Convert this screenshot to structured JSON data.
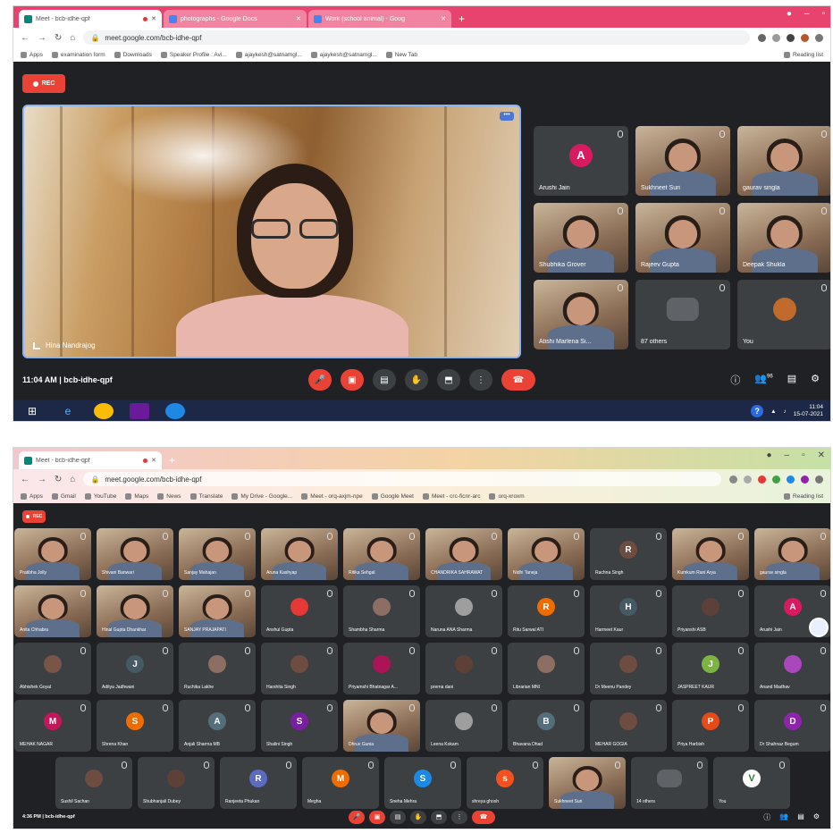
{
  "screen1": {
    "tabs": [
      {
        "label": "Meet - bcb-idhe-qpf",
        "active": true,
        "icon": "meet-icon"
      },
      {
        "label": "photographs - Google Docs",
        "active": false,
        "icon": "docs-icon"
      },
      {
        "label": "Work (school animal) - Goog",
        "active": false,
        "icon": "docs-icon"
      }
    ],
    "url": "meet.google.com/bcb-idhe-qpf",
    "bookmarks": [
      "Apps",
      "examination form",
      "Downloads",
      "Speaker Profile : Avi...",
      "ajaykesh@satnamgl...",
      "ajaykesh@satnamgl...",
      "New Tab"
    ],
    "bookmarks_right": "Reading list",
    "rec_label": "REC",
    "main_speaker": "Hina Nandrajog",
    "tiles": [
      {
        "name": "Arushi Jain",
        "initial": "A",
        "color": "#d81b60",
        "camera": false
      },
      {
        "name": "Sukhneet Suri",
        "camera": true
      },
      {
        "name": "gaurav singla",
        "camera": true
      },
      {
        "name": "Shubhika Grover",
        "camera": true
      },
      {
        "name": "Rajeev Gupta",
        "camera": true
      },
      {
        "name": "Deepak Shukla",
        "camera": true
      },
      {
        "name": "Atishi Marlena Si...",
        "camera": true
      },
      {
        "name": "87 others",
        "camera": false,
        "group": true
      },
      {
        "name": "You",
        "camera": false,
        "self": true
      }
    ],
    "time": "11:04 AM",
    "meeting_code": "bcb-idhe-qpf",
    "participant_count": "96",
    "tray_time": "11:04",
    "tray_date": "15-07-2021"
  },
  "screen2": {
    "tabs": [
      {
        "label": "Meet - bcb-idhe-qpf",
        "active": true,
        "icon": "meet-icon"
      }
    ],
    "url": "meet.google.com/bcb-idhe-qpf",
    "bookmarks": [
      "Apps",
      "Gmail",
      "YouTube",
      "Maps",
      "News",
      "Translate",
      "My Drive - Google...",
      "Meet - orq-axjm-npe",
      "Google Meet",
      "Meet - crc-ficnr-arc",
      "orq-xroxm"
    ],
    "bookmarks_right": "Reading list",
    "rec_label": "REC",
    "rows": [
      [
        {
          "name": "Pratibha Jolly",
          "camera": true
        },
        {
          "name": "Shivani Banwari",
          "camera": true
        },
        {
          "name": "Sanjay Mahajan",
          "camera": true
        },
        {
          "name": "Aruna Kashyap",
          "camera": true
        },
        {
          "name": "Ritika Sehgal",
          "camera": true
        },
        {
          "name": "CHANDRIKA SAHRAWAT",
          "camera": true
        },
        {
          "name": "Nidhi Taneja",
          "camera": true
        },
        {
          "name": "Rachna Singh",
          "initial": "R",
          "color": "#6d4c41",
          "camera": false
        },
        {
          "name": "Kumkum Rani Arya",
          "camera": true
        },
        {
          "name": "gaurav singla",
          "camera": true
        }
      ],
      [
        {
          "name": "Anita Chhabra",
          "camera": true
        },
        {
          "name": "Hinal Gupta Dhankhar",
          "camera": true
        },
        {
          "name": "SANJAY PRAJAPATI",
          "camera": true
        },
        {
          "name": "Anshul Gupta",
          "initial": "",
          "color": "#e53935",
          "camera": false
        },
        {
          "name": "Shambha Sharma",
          "initial": "",
          "color": "#8d6e63",
          "camera": false
        },
        {
          "name": "Naruna ANA Sharma",
          "initial": "",
          "color": "#9e9e9e",
          "camera": false
        },
        {
          "name": "Ritu Sarwal ATI",
          "initial": "R",
          "color": "#ef6c00",
          "camera": false
        },
        {
          "name": "Harmeet Kaur",
          "initial": "H",
          "color": "#455a64",
          "camera": false
        },
        {
          "name": "Priyanshi ASB",
          "initial": "",
          "color": "#5d4037",
          "camera": false
        },
        {
          "name": "Arushi Jain",
          "initial": "A",
          "color": "#d81b60",
          "camera": false
        }
      ],
      [
        {
          "name": "Abhishek Goyal",
          "initial": "",
          "color": "#795548",
          "camera": false
        },
        {
          "name": "Aditya Jadhwani",
          "initial": "J",
          "color": "#455a64",
          "camera": false
        },
        {
          "name": "Ruchika Lakhe",
          "initial": "",
          "color": "#8d6e63",
          "camera": false
        },
        {
          "name": "Harshita Singh",
          "initial": "",
          "color": "#6d4c41",
          "camera": false
        },
        {
          "name": "Priyamshi Bhatnagar A...",
          "initial": "",
          "color": "#ad1457",
          "camera": false
        },
        {
          "name": "prerna dani",
          "initial": "",
          "color": "#5d4037",
          "camera": false
        },
        {
          "name": "Librarian MNI",
          "initial": "",
          "color": "#8d6e63",
          "camera": false
        },
        {
          "name": "Dr Meenu Pandey",
          "initial": "",
          "color": "#6d4c41",
          "camera": false
        },
        {
          "name": "JASPREET KAUR",
          "initial": "J",
          "color": "#7cb342",
          "camera": false
        },
        {
          "name": "Anand Madhav",
          "initial": "",
          "color": "#ab47bc",
          "camera": false
        }
      ],
      [
        {
          "name": "MEHAK NAGAR",
          "initial": "M",
          "color": "#c2185b",
          "camera": false
        },
        {
          "name": "Shrena Khan",
          "initial": "S",
          "color": "#ef6c00",
          "camera": false
        },
        {
          "name": "Anjali Sharma MB",
          "initial": "A",
          "color": "#546e7a",
          "camera": false
        },
        {
          "name": "Shalini Singh",
          "initial": "S",
          "color": "#7b1fa2",
          "camera": false
        },
        {
          "name": "Dhruv Gunia",
          "camera": true
        },
        {
          "name": "Leena Kokam",
          "initial": "",
          "color": "#9e9e9e",
          "camera": false
        },
        {
          "name": "Bhavana Dhad",
          "initial": "B",
          "color": "#546e7a",
          "camera": false
        },
        {
          "name": "MEHAR GOGIA",
          "initial": "",
          "color": "#6d4c41",
          "camera": false
        },
        {
          "name": "Priya Harbish",
          "initial": "P",
          "color": "#e64a19",
          "camera": false
        },
        {
          "name": "Dr Shahnaz Begum",
          "initial": "D",
          "color": "#8e24aa",
          "camera": false
        }
      ],
      [
        {
          "name": "Sushil Sachan",
          "initial": "",
          "color": "#6d4c41",
          "camera": false
        },
        {
          "name": "Shubhanjali Dubey",
          "initial": "",
          "color": "#5d4037",
          "camera": false
        },
        {
          "name": "Ranjeeta Phukan",
          "initial": "R",
          "color": "#5c6bc0",
          "camera": false
        },
        {
          "name": "Megha",
          "initial": "M",
          "color": "#ef6c00",
          "camera": false
        },
        {
          "name": "Sneha Mehra",
          "initial": "S",
          "color": "#1e88e5",
          "camera": false
        },
        {
          "name": "shreya ghosh",
          "initial": "s",
          "color": "#f4511e",
          "camera": false
        },
        {
          "name": "Sukhneet Suri",
          "camera": true
        },
        {
          "name": "14 others",
          "group": true,
          "camera": false
        },
        {
          "name": "You",
          "initial": "V",
          "color": "#ffffff",
          "camera": false,
          "self": true
        }
      ]
    ],
    "time": "4:36 PM",
    "meeting_code": "bcb-idhe-qpf"
  }
}
